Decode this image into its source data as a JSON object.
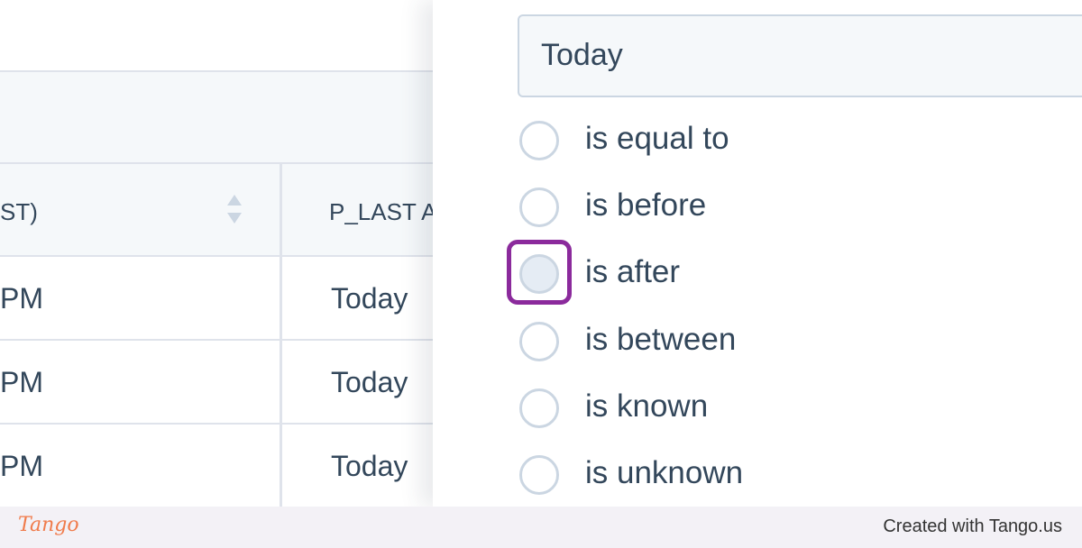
{
  "table": {
    "header": {
      "col1_partial": "ST)",
      "col2_partial": "P_LAST A"
    },
    "rows": [
      {
        "col1": "PM",
        "col2": "Today"
      },
      {
        "col1": "PM",
        "col2": "Today"
      },
      {
        "col1": "PM",
        "col2": "Today"
      }
    ]
  },
  "filter_panel": {
    "value_input": "Today",
    "options": [
      {
        "label": "is equal to",
        "selected": false
      },
      {
        "label": "is before",
        "selected": false
      },
      {
        "label": "is after",
        "selected": false,
        "hovered": true
      },
      {
        "label": "is between",
        "selected": false
      },
      {
        "label": "is known",
        "selected": false
      },
      {
        "label": "is unknown",
        "selected": false
      }
    ],
    "highlight_color": "#8b2a9c"
  },
  "footer": {
    "brand": "Tango",
    "credit": "Created with Tango.us"
  },
  "colors": {
    "text": "#33475b",
    "border": "#dfe3eb",
    "band": "#f5f8fa",
    "brand": "#f07b4b"
  }
}
